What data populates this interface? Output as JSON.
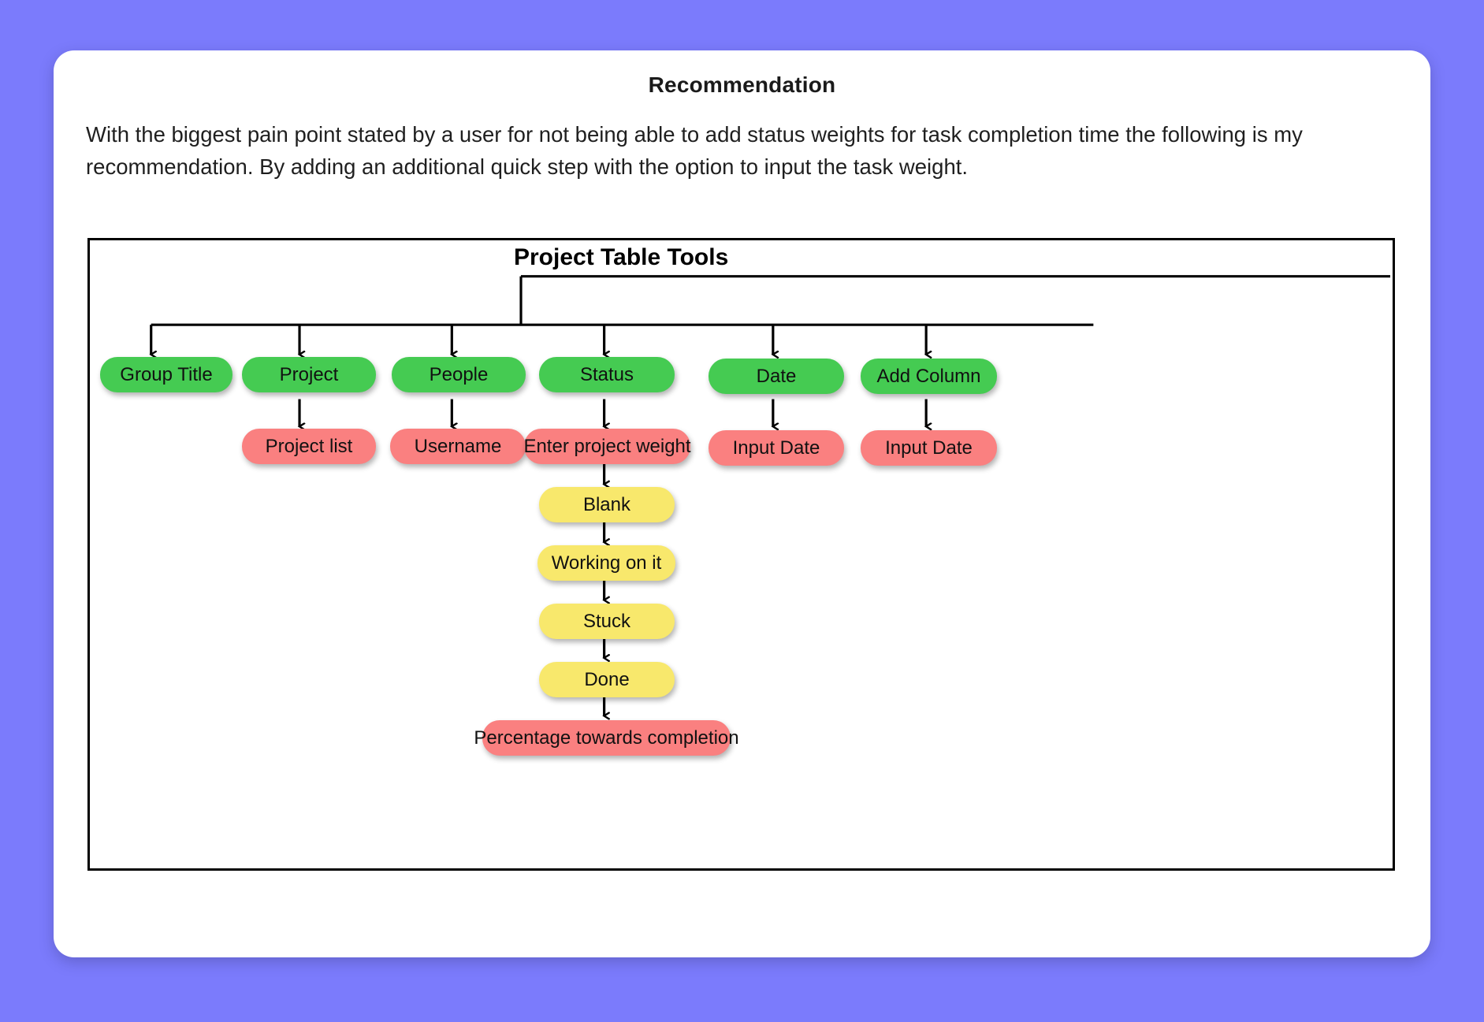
{
  "page": {
    "background_color": "#7b7bfc",
    "card_background": "#ffffff"
  },
  "card": {
    "title": "Recommendation",
    "body_text": "With the biggest pain point stated by a user for not being able to add status weights for task completion time the following is my recommendation. By adding an additional quick step with the option to input the task weight."
  },
  "diagram": {
    "title": "Project Table Tools",
    "colors": {
      "green": "#45cb52",
      "red": "#fa8080",
      "yellow": "#f8e86c",
      "line": "#000000"
    },
    "columns": [
      {
        "id": "group-title",
        "root": {
          "label": "Group Title",
          "color": "green"
        },
        "children": []
      },
      {
        "id": "project",
        "root": {
          "label": "Project",
          "color": "green"
        },
        "children": [
          {
            "label": "Project list",
            "color": "red"
          }
        ]
      },
      {
        "id": "people",
        "root": {
          "label": "People",
          "color": "green"
        },
        "children": [
          {
            "label": "Username",
            "color": "red"
          }
        ]
      },
      {
        "id": "status",
        "root": {
          "label": "Status",
          "color": "green"
        },
        "children": [
          {
            "label": "Enter project weight",
            "color": "red"
          },
          {
            "label": "Blank",
            "color": "yellow"
          },
          {
            "label": "Working on it",
            "color": "yellow"
          },
          {
            "label": "Stuck",
            "color": "yellow"
          },
          {
            "label": "Done",
            "color": "yellow"
          },
          {
            "label": "Percentage towards completion",
            "color": "red"
          }
        ]
      },
      {
        "id": "date",
        "root": {
          "label": "Date",
          "color": "green"
        },
        "children": [
          {
            "label": "Input Date",
            "color": "red"
          }
        ]
      },
      {
        "id": "add-column",
        "root": {
          "label": "Add Column",
          "color": "green"
        },
        "children": [
          {
            "label": "Input Date",
            "color": "red"
          }
        ]
      }
    ],
    "nodes": {
      "group_title": "Group Title",
      "project": "Project",
      "project_list": "Project list",
      "people": "People",
      "username": "Username",
      "status": "Status",
      "enter_project_weight": "Enter project weight",
      "blank": "Blank",
      "working_on_it": "Working on it",
      "stuck": "Stuck",
      "done": "Done",
      "percentage": "Percentage towards completion",
      "date": "Date",
      "input_date_1": "Input Date",
      "add_column": "Add Column",
      "input_date_2": "Input Date"
    }
  }
}
